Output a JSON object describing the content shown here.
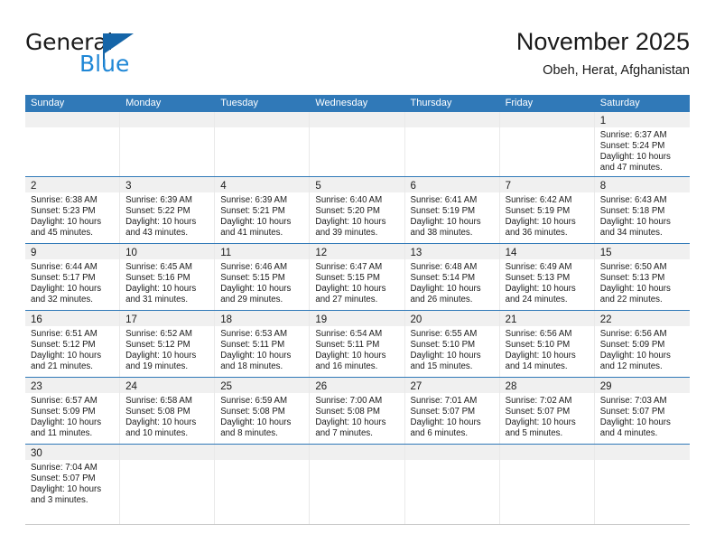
{
  "brand": {
    "name_part1": "General",
    "name_part2": "Blue",
    "flag_icon": "triangle-flag-icon",
    "color_black": "#1a1a1a",
    "color_blue": "#1f87d6"
  },
  "header": {
    "title": "November 2025",
    "subtitle": "Obeh, Herat, Afghanistan"
  },
  "theme": {
    "header_blue": "#3079b8",
    "daynum_strip_gray": "#f0f0f0",
    "row_divider_blue": "#3079b8",
    "text": "#1a1a1a"
  },
  "weekdays": [
    "Sunday",
    "Monday",
    "Tuesday",
    "Wednesday",
    "Thursday",
    "Friday",
    "Saturday"
  ],
  "weeks": [
    [
      {
        "day": "",
        "lines": []
      },
      {
        "day": "",
        "lines": []
      },
      {
        "day": "",
        "lines": []
      },
      {
        "day": "",
        "lines": []
      },
      {
        "day": "",
        "lines": []
      },
      {
        "day": "",
        "lines": []
      },
      {
        "day": "1",
        "lines": [
          "Sunrise: 6:37 AM",
          "Sunset: 5:24 PM",
          "Daylight: 10 hours",
          "and 47 minutes."
        ]
      }
    ],
    [
      {
        "day": "2",
        "lines": [
          "Sunrise: 6:38 AM",
          "Sunset: 5:23 PM",
          "Daylight: 10 hours",
          "and 45 minutes."
        ]
      },
      {
        "day": "3",
        "lines": [
          "Sunrise: 6:39 AM",
          "Sunset: 5:22 PM",
          "Daylight: 10 hours",
          "and 43 minutes."
        ]
      },
      {
        "day": "4",
        "lines": [
          "Sunrise: 6:39 AM",
          "Sunset: 5:21 PM",
          "Daylight: 10 hours",
          "and 41 minutes."
        ]
      },
      {
        "day": "5",
        "lines": [
          "Sunrise: 6:40 AM",
          "Sunset: 5:20 PM",
          "Daylight: 10 hours",
          "and 39 minutes."
        ]
      },
      {
        "day": "6",
        "lines": [
          "Sunrise: 6:41 AM",
          "Sunset: 5:19 PM",
          "Daylight: 10 hours",
          "and 38 minutes."
        ]
      },
      {
        "day": "7",
        "lines": [
          "Sunrise: 6:42 AM",
          "Sunset: 5:19 PM",
          "Daylight: 10 hours",
          "and 36 minutes."
        ]
      },
      {
        "day": "8",
        "lines": [
          "Sunrise: 6:43 AM",
          "Sunset: 5:18 PM",
          "Daylight: 10 hours",
          "and 34 minutes."
        ]
      }
    ],
    [
      {
        "day": "9",
        "lines": [
          "Sunrise: 6:44 AM",
          "Sunset: 5:17 PM",
          "Daylight: 10 hours",
          "and 32 minutes."
        ]
      },
      {
        "day": "10",
        "lines": [
          "Sunrise: 6:45 AM",
          "Sunset: 5:16 PM",
          "Daylight: 10 hours",
          "and 31 minutes."
        ]
      },
      {
        "day": "11",
        "lines": [
          "Sunrise: 6:46 AM",
          "Sunset: 5:15 PM",
          "Daylight: 10 hours",
          "and 29 minutes."
        ]
      },
      {
        "day": "12",
        "lines": [
          "Sunrise: 6:47 AM",
          "Sunset: 5:15 PM",
          "Daylight: 10 hours",
          "and 27 minutes."
        ]
      },
      {
        "day": "13",
        "lines": [
          "Sunrise: 6:48 AM",
          "Sunset: 5:14 PM",
          "Daylight: 10 hours",
          "and 26 minutes."
        ]
      },
      {
        "day": "14",
        "lines": [
          "Sunrise: 6:49 AM",
          "Sunset: 5:13 PM",
          "Daylight: 10 hours",
          "and 24 minutes."
        ]
      },
      {
        "day": "15",
        "lines": [
          "Sunrise: 6:50 AM",
          "Sunset: 5:13 PM",
          "Daylight: 10 hours",
          "and 22 minutes."
        ]
      }
    ],
    [
      {
        "day": "16",
        "lines": [
          "Sunrise: 6:51 AM",
          "Sunset: 5:12 PM",
          "Daylight: 10 hours",
          "and 21 minutes."
        ]
      },
      {
        "day": "17",
        "lines": [
          "Sunrise: 6:52 AM",
          "Sunset: 5:12 PM",
          "Daylight: 10 hours",
          "and 19 minutes."
        ]
      },
      {
        "day": "18",
        "lines": [
          "Sunrise: 6:53 AM",
          "Sunset: 5:11 PM",
          "Daylight: 10 hours",
          "and 18 minutes."
        ]
      },
      {
        "day": "19",
        "lines": [
          "Sunrise: 6:54 AM",
          "Sunset: 5:11 PM",
          "Daylight: 10 hours",
          "and 16 minutes."
        ]
      },
      {
        "day": "20",
        "lines": [
          "Sunrise: 6:55 AM",
          "Sunset: 5:10 PM",
          "Daylight: 10 hours",
          "and 15 minutes."
        ]
      },
      {
        "day": "21",
        "lines": [
          "Sunrise: 6:56 AM",
          "Sunset: 5:10 PM",
          "Daylight: 10 hours",
          "and 14 minutes."
        ]
      },
      {
        "day": "22",
        "lines": [
          "Sunrise: 6:56 AM",
          "Sunset: 5:09 PM",
          "Daylight: 10 hours",
          "and 12 minutes."
        ]
      }
    ],
    [
      {
        "day": "23",
        "lines": [
          "Sunrise: 6:57 AM",
          "Sunset: 5:09 PM",
          "Daylight: 10 hours",
          "and 11 minutes."
        ]
      },
      {
        "day": "24",
        "lines": [
          "Sunrise: 6:58 AM",
          "Sunset: 5:08 PM",
          "Daylight: 10 hours",
          "and 10 minutes."
        ]
      },
      {
        "day": "25",
        "lines": [
          "Sunrise: 6:59 AM",
          "Sunset: 5:08 PM",
          "Daylight: 10 hours",
          "and 8 minutes."
        ]
      },
      {
        "day": "26",
        "lines": [
          "Sunrise: 7:00 AM",
          "Sunset: 5:08 PM",
          "Daylight: 10 hours",
          "and 7 minutes."
        ]
      },
      {
        "day": "27",
        "lines": [
          "Sunrise: 7:01 AM",
          "Sunset: 5:07 PM",
          "Daylight: 10 hours",
          "and 6 minutes."
        ]
      },
      {
        "day": "28",
        "lines": [
          "Sunrise: 7:02 AM",
          "Sunset: 5:07 PM",
          "Daylight: 10 hours",
          "and 5 minutes."
        ]
      },
      {
        "day": "29",
        "lines": [
          "Sunrise: 7:03 AM",
          "Sunset: 5:07 PM",
          "Daylight: 10 hours",
          "and 4 minutes."
        ]
      }
    ],
    [
      {
        "day": "30",
        "lines": [
          "Sunrise: 7:04 AM",
          "Sunset: 5:07 PM",
          "Daylight: 10 hours",
          "and 3 minutes."
        ]
      },
      {
        "day": "",
        "lines": []
      },
      {
        "day": "",
        "lines": []
      },
      {
        "day": "",
        "lines": []
      },
      {
        "day": "",
        "lines": []
      },
      {
        "day": "",
        "lines": []
      },
      {
        "day": "",
        "lines": []
      }
    ]
  ]
}
